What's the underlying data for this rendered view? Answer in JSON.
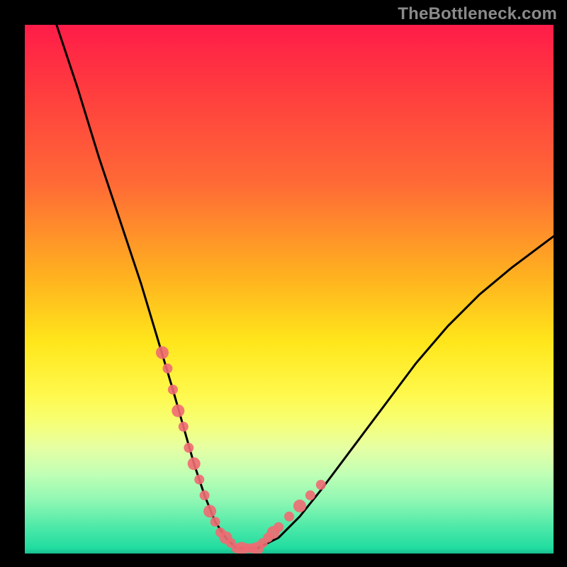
{
  "watermark": "TheBottleneck.com",
  "chart_data": {
    "type": "line",
    "title": "",
    "xlabel": "",
    "ylabel": "",
    "xlim": [
      0,
      100
    ],
    "ylim": [
      0,
      100
    ],
    "series": [
      {
        "name": "bottleneck-curve",
        "x": [
          6,
          10,
          14,
          18,
          22,
          25,
          28,
          30,
          32,
          34,
          36,
          38,
          40,
          44,
          48,
          52,
          56,
          62,
          68,
          74,
          80,
          86,
          92,
          100
        ],
        "y": [
          100,
          88,
          75,
          63,
          51,
          41,
          31,
          24,
          17,
          11,
          6,
          3,
          1,
          1,
          3,
          7,
          12,
          20,
          28,
          36,
          43,
          49,
          54,
          60
        ]
      }
    ],
    "highlight_points": {
      "name": "bottleneck-markers",
      "x": [
        26,
        27,
        28,
        29,
        30,
        31,
        32,
        33,
        34,
        35,
        36,
        37,
        38,
        39,
        40,
        41,
        42,
        43,
        44,
        45,
        46,
        47,
        48,
        50,
        52,
        54,
        56
      ],
      "y": [
        38,
        35,
        31,
        27,
        24,
        20,
        17,
        14,
        11,
        8,
        6,
        4,
        3,
        2,
        1,
        1,
        1,
        1,
        1,
        2,
        3,
        4,
        5,
        7,
        9,
        11,
        13
      ]
    },
    "marker_color": "#f06a72",
    "curve_color": "#000000"
  }
}
